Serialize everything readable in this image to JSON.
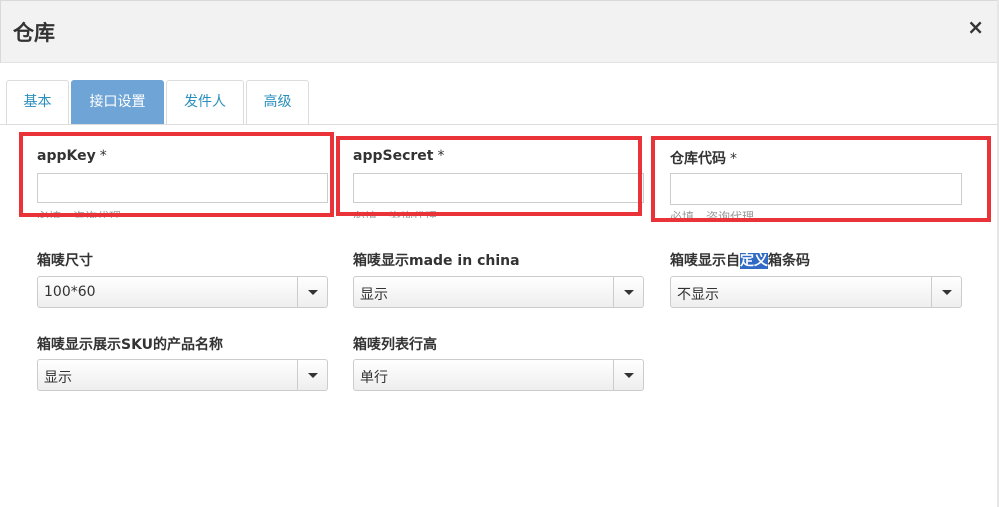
{
  "dialog": {
    "title": "仓库",
    "close_symbol": "×"
  },
  "tabs": [
    {
      "label": "基本",
      "active": false
    },
    {
      "label": "接口设置",
      "active": true
    },
    {
      "label": "发件人",
      "active": false
    },
    {
      "label": "高级",
      "active": false
    }
  ],
  "fields": {
    "app_key": {
      "label": "appKey",
      "required": "*",
      "value": "",
      "help": "必填，咨询代理"
    },
    "app_secret": {
      "label": "appSecret",
      "required": "*",
      "value": "",
      "help": "必填，咨询代理"
    },
    "warehouse_code": {
      "label": "仓库代码",
      "required": "*",
      "value": "",
      "help": "必填，咨询代理"
    }
  },
  "selects": {
    "label_size": {
      "label": "箱唛尺寸",
      "value": "100*60"
    },
    "made_in_china": {
      "label": "箱唛显示made in china",
      "value": "显示"
    },
    "custom_barcode": {
      "label_pre": "箱唛显示自",
      "label_hl": "定义",
      "label_post": "箱条码",
      "value": "不显示"
    },
    "show_sku_name": {
      "label": "箱唛显示展示SKU的产品名称",
      "value": "显示"
    },
    "row_height": {
      "label": "箱唛列表行高",
      "value": "单行"
    }
  },
  "colors": {
    "highlight_border": "#ea3339",
    "active_tab": "#6fa5d6",
    "tab_text": "#2a8fbd"
  }
}
